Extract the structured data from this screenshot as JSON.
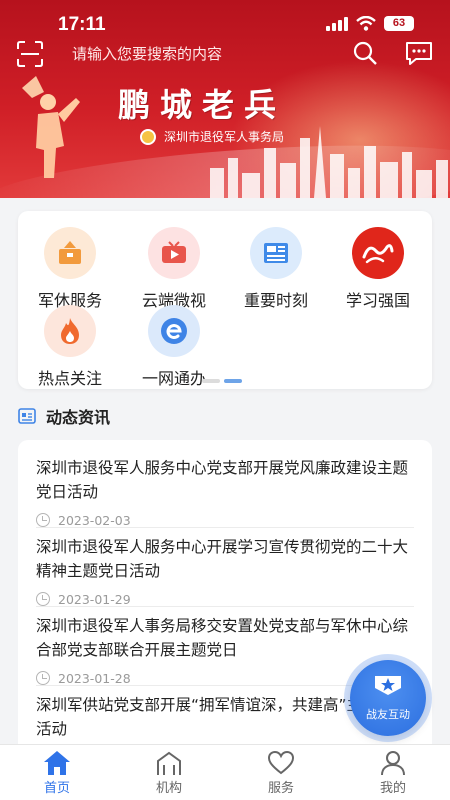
{
  "status": {
    "time": "17:11",
    "battery": "63"
  },
  "search": {
    "placeholder": "请输入您要搜索的内容"
  },
  "banner": {
    "title": "鹏城老兵",
    "subtitle": "深圳市退役军人事务局"
  },
  "services": [
    {
      "label": "军休服务",
      "icon": "box-icon",
      "bg": "#fde9d6",
      "fg": "#f29a3c"
    },
    {
      "label": "云端微视",
      "icon": "video-icon",
      "bg": "#fde2e2",
      "fg": "#e8554b"
    },
    {
      "label": "重要时刻",
      "icon": "news-icon",
      "bg": "#dcebfc",
      "fg": "#3f8ae8"
    },
    {
      "label": "学习强国",
      "icon": "xuexi-logo-icon",
      "bg": "#e0261b",
      "fg": "#ffffff"
    },
    {
      "label": "热点关注",
      "icon": "flame-icon",
      "bg": "#fde6dc",
      "fg": "#f06a2e"
    },
    {
      "label": "一网通办",
      "icon": "e-service-icon",
      "bg": "#dbe9fb",
      "fg": "#3f84e6"
    }
  ],
  "news_section": {
    "title": "动态资讯"
  },
  "news": [
    {
      "title": "深圳市退役军人服务中心党支部开展党风廉政建设主题党日活动",
      "date": "2023-02-03"
    },
    {
      "title": "深圳市退役军人服务中心开展学习宣传贯彻党的二十大精神主题党日活动",
      "date": "2023-01-29"
    },
    {
      "title": "深圳市退役军人事务局移交安置处党支部与军休中心综合部党支部联合开展主题党日",
      "date": "2023-01-28"
    },
    {
      "title": "深圳军供站党支部开展“拥军情谊深，共建高”主题党日活动",
      "date": ""
    }
  ],
  "float_button": {
    "label": "战友互动"
  },
  "tabs": [
    {
      "label": "首页",
      "active": true
    },
    {
      "label": "机构",
      "active": false
    },
    {
      "label": "服务",
      "active": false
    },
    {
      "label": "我的",
      "active": false
    }
  ],
  "colors": {
    "brand_red": "#c9151f",
    "accent_blue": "#2f73e8"
  }
}
